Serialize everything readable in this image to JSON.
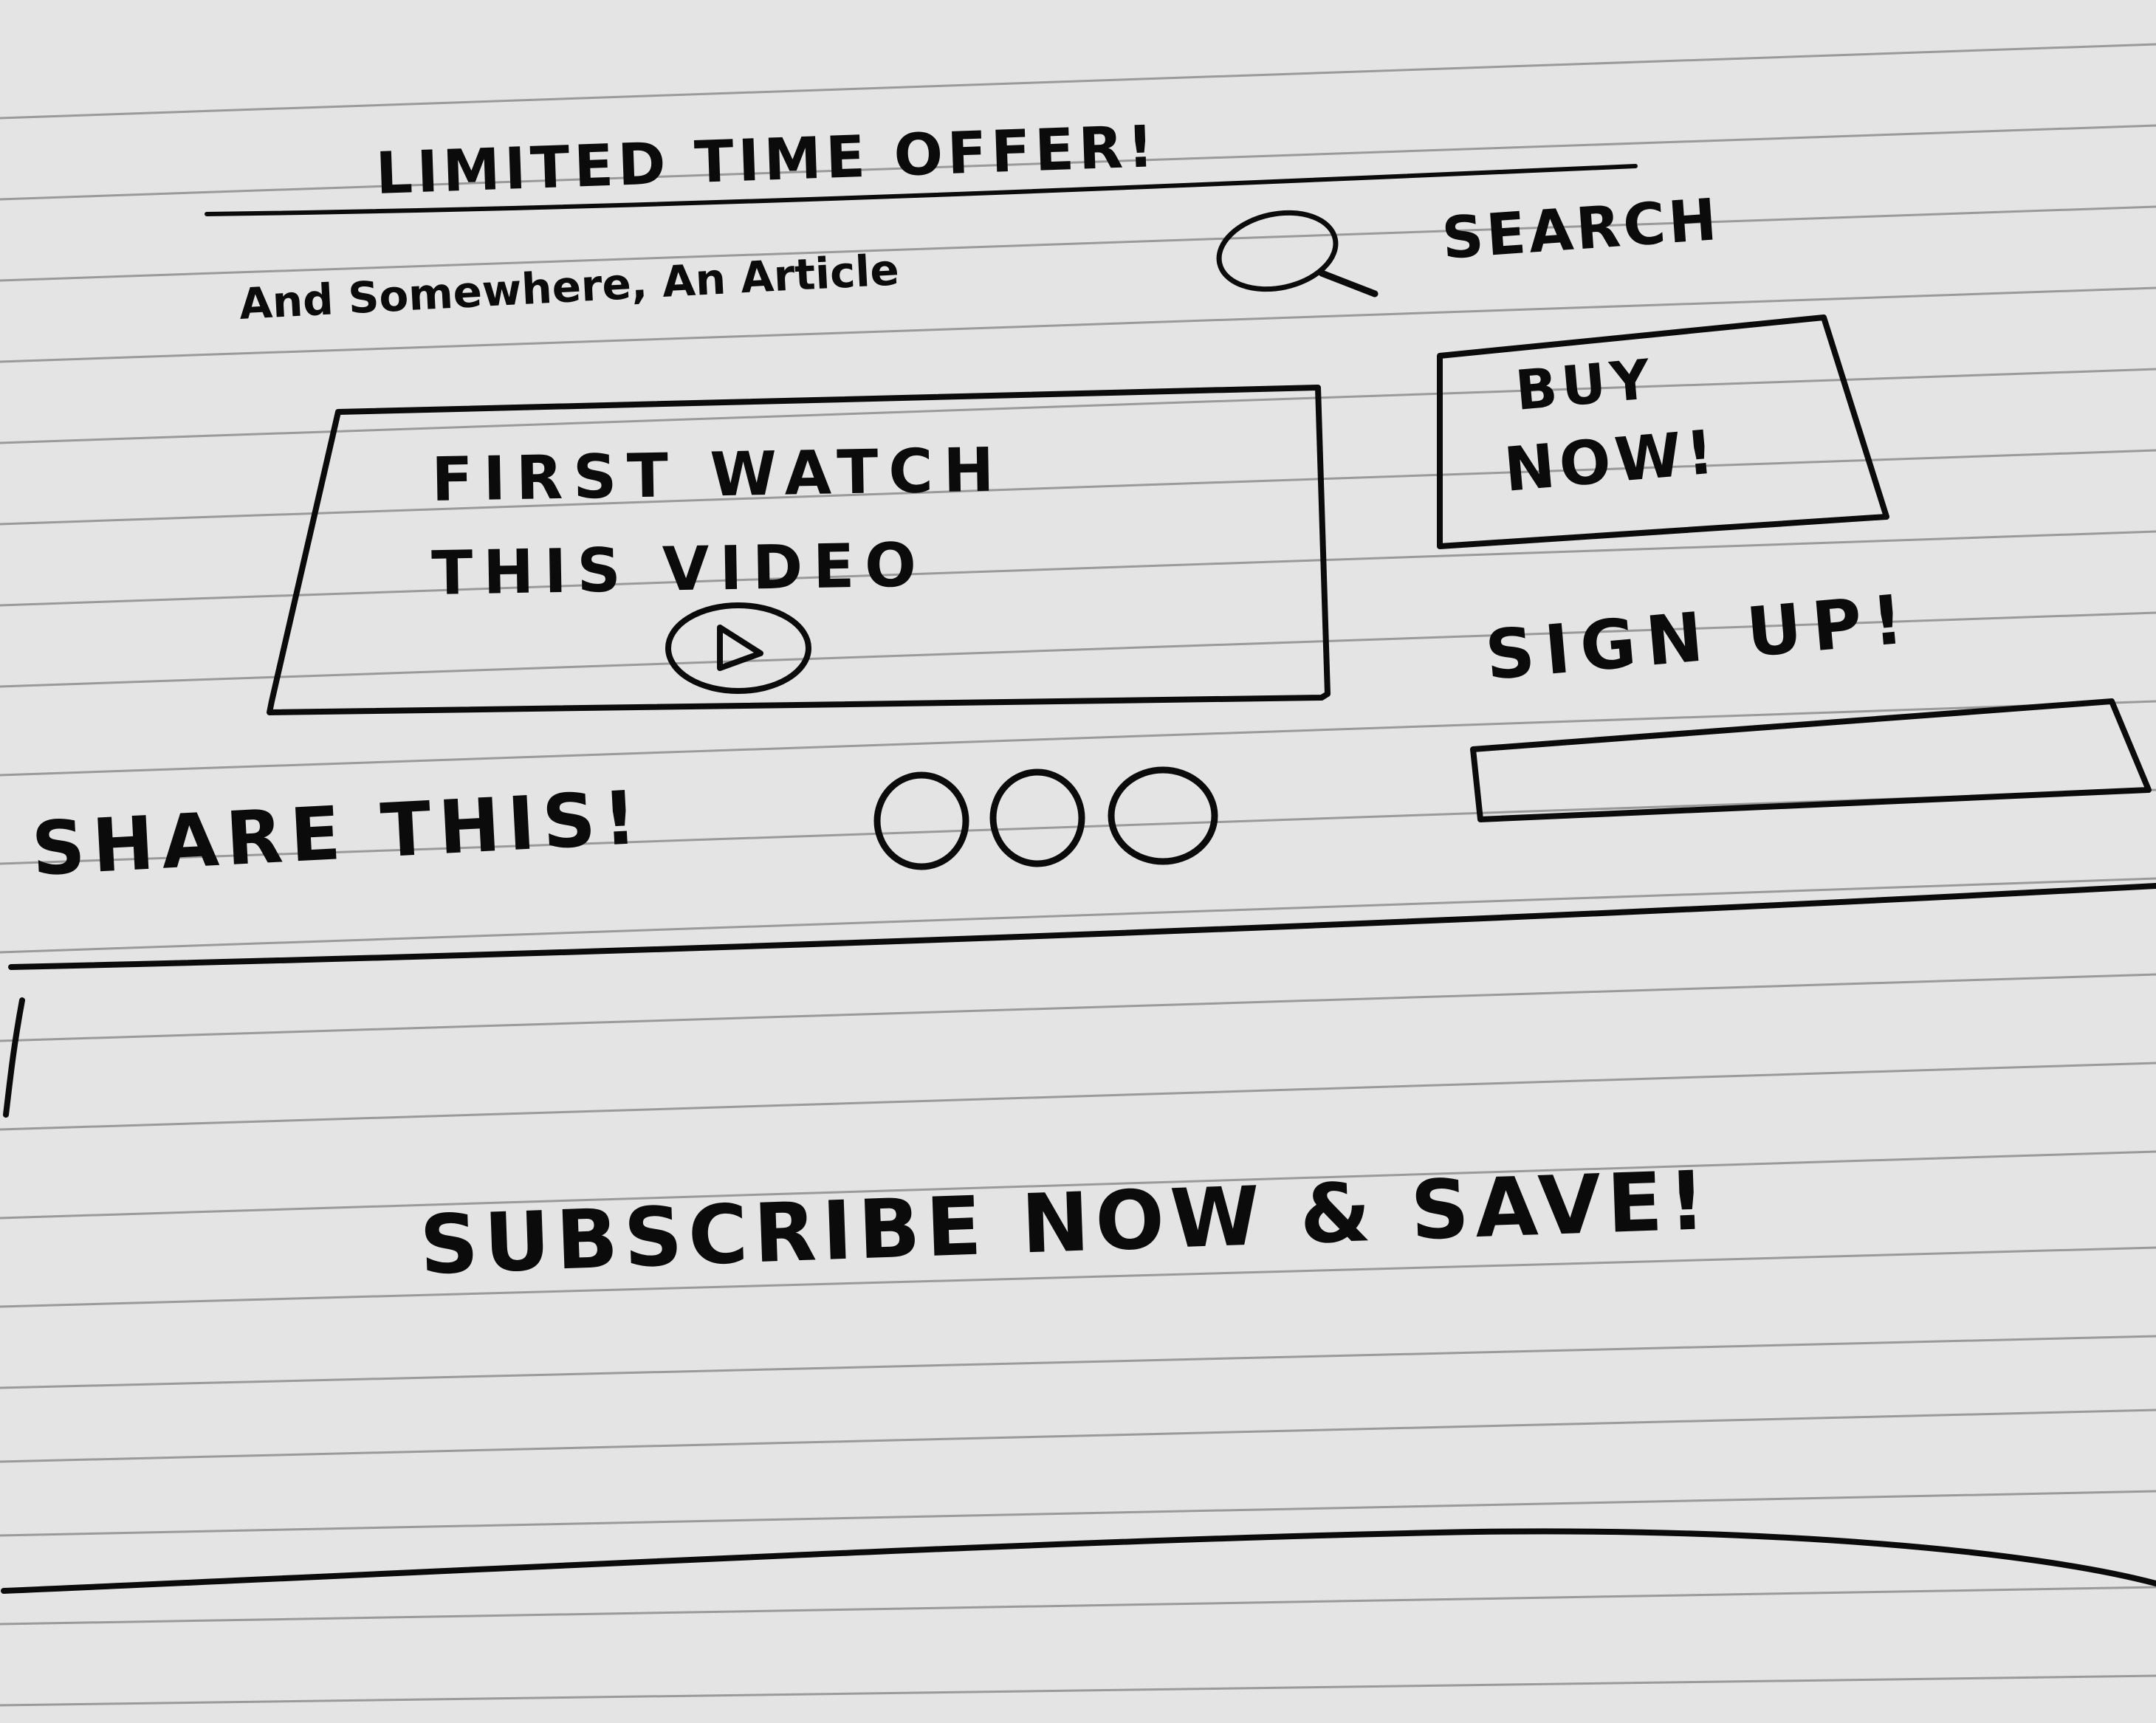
{
  "banner": {
    "offer_text": "LIMITED TIME OFFER!"
  },
  "header": {
    "article_title": "And Somewhere, An Article",
    "search_label": "SEARCH",
    "search_icon": "magnifier-icon"
  },
  "video": {
    "line1": "FIRST WATCH",
    "line2": "THIS VIDEO",
    "play_icon": "play-icon"
  },
  "sidebar": {
    "buy_line1": "BUY",
    "buy_line2": "NOW!",
    "signup_label": "SIGN UP!",
    "signup_input_value": ""
  },
  "share": {
    "label": "SHARE THIS!",
    "icons": [
      "share-circle-icon",
      "share-circle-icon",
      "share-circle-icon"
    ]
  },
  "footer_banner": {
    "text": "SUBSCRIBE NOW & SAVE!"
  },
  "colors": {
    "paper": "#e4e4e4",
    "ink": "#0b0b0b",
    "ruled_line": "#9a9a9a"
  }
}
